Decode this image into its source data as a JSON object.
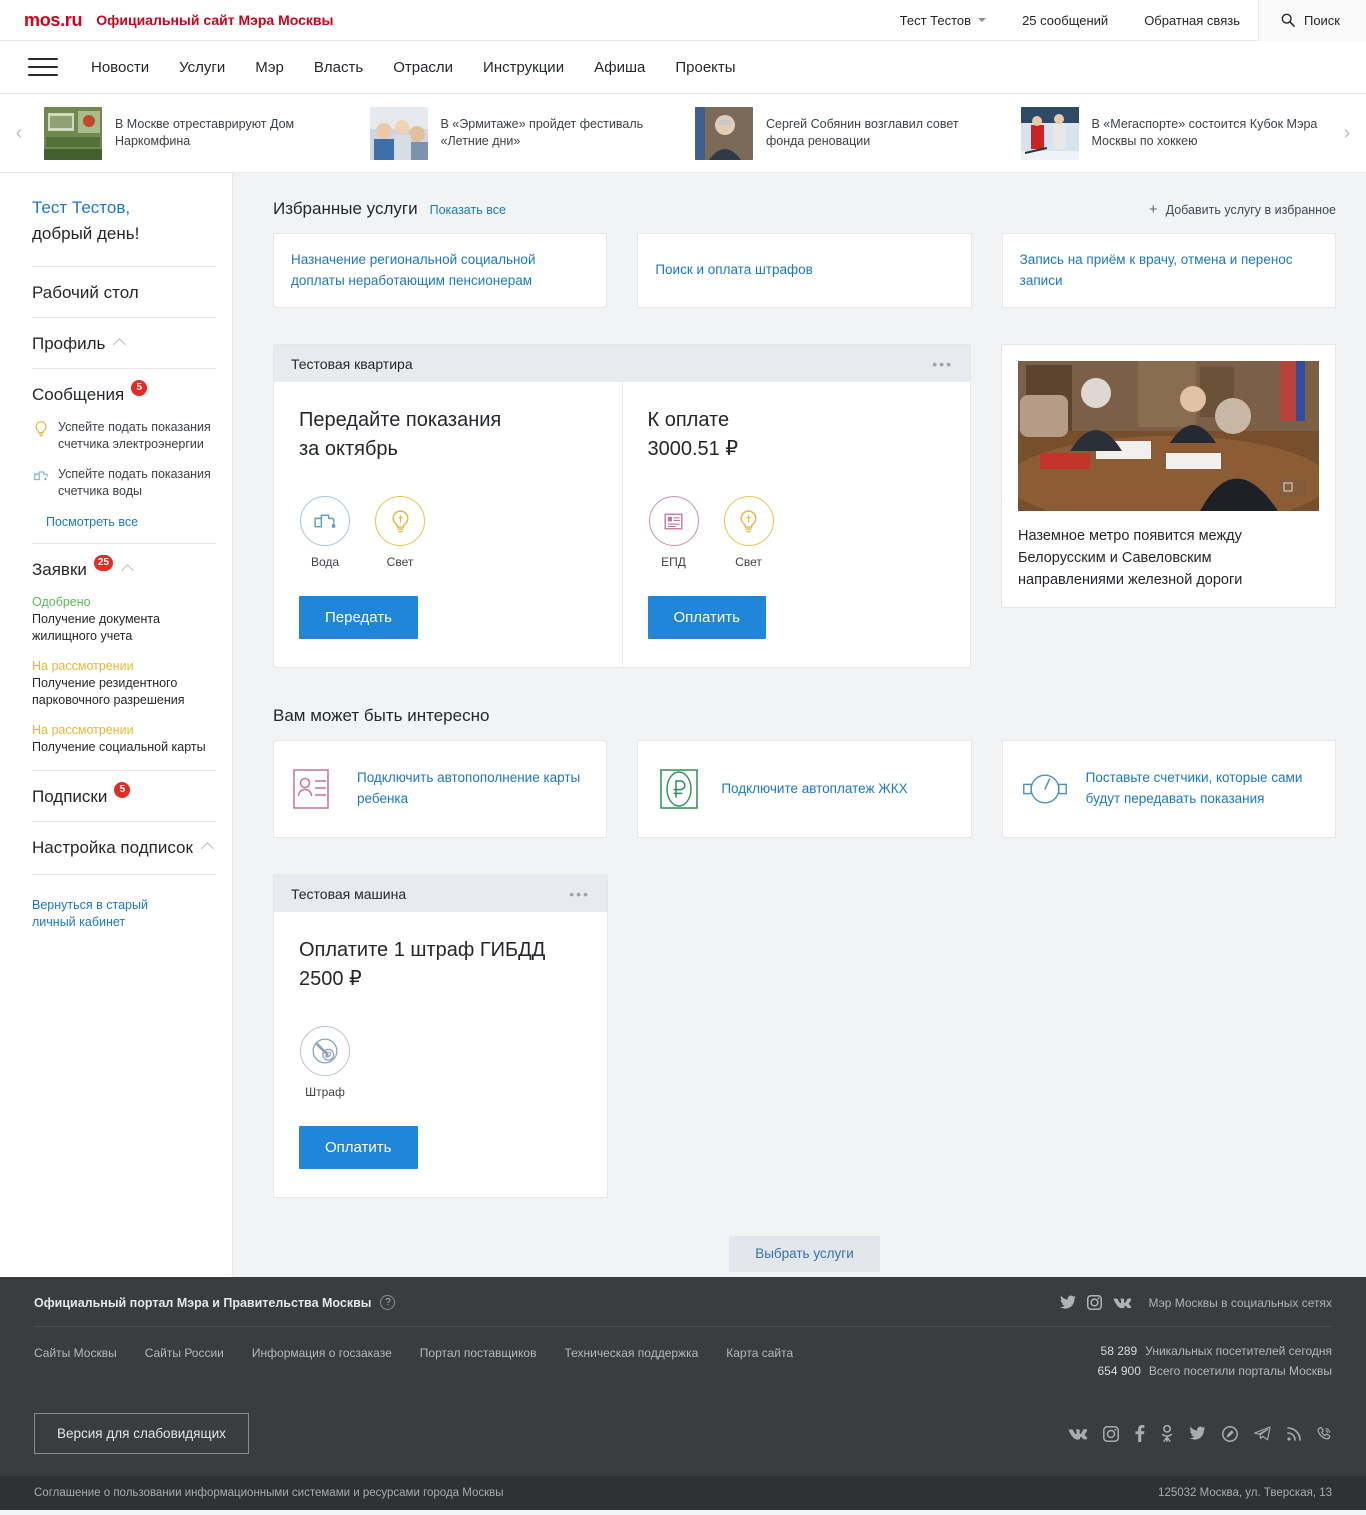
{
  "topbar": {
    "logo": "mos.ru",
    "tagline": "Официальный сайт Мэра Москвы",
    "user": "Тест Тестов",
    "messages": "25 сообщений",
    "feedback": "Обратная связь",
    "search": "Поиск"
  },
  "nav": {
    "items": [
      "Новости",
      "Услуги",
      "Мэр",
      "Власть",
      "Отрасли",
      "Инструкции",
      "Афиша",
      "Проекты"
    ]
  },
  "ticker": {
    "items": [
      {
        "title": "В Москве отреставрируют Дом Наркомфина"
      },
      {
        "title": "В «Эрмитаже» пройдет фестиваль «Летние дни»"
      },
      {
        "title": "Сергей Собянин возглавил совет фонда реновации"
      },
      {
        "title": "В «Мегаспорте» состоится Кубок Мэра Москвы по хоккею"
      }
    ]
  },
  "sidebar": {
    "greeting_name": "Тест Тестов,",
    "greeting_text": "добрый день!",
    "desktop": "Рабочий стол",
    "profile": "Профиль",
    "messages_label": "Сообщения",
    "messages_badge": "5",
    "messages": [
      {
        "icon": "lightbulb-icon",
        "text": "Успейте подать показания счетчика электроэнергии"
      },
      {
        "icon": "faucet-icon",
        "text": "Успейте подать показания счетчика воды"
      }
    ],
    "view_all": "Посмотреть все",
    "requests_label": "Заявки",
    "requests_badge": "25",
    "requests": [
      {
        "status": "Одобрено",
        "status_type": "ok",
        "title": "Получение документа жилищного учета"
      },
      {
        "status": "На рассмотрении",
        "status_type": "pending",
        "title": "Получение резидентного парковочного разрешения"
      },
      {
        "status": "На рассмотрении",
        "status_type": "pending",
        "title": "Получение социальной карты"
      }
    ],
    "subscriptions_label": "Подписки",
    "subscriptions_badge": "5",
    "subscriptions_settings": "Настройка подписок",
    "back_link_line1": "Вернуться в старый",
    "back_link_line2": "личный кабинет"
  },
  "favorites": {
    "title": "Избранные услуги",
    "show_all": "Показать все",
    "add_label": "Добавить услугу в избранное",
    "cards": [
      "Назначение региональной социальной доплаты неработающим пенсионерам",
      "Поиск и оплата штрафов",
      "Запись на приём к врачу, отмена и перенос записи"
    ]
  },
  "flat_widget": {
    "title": "Тестовая квартира",
    "left": {
      "heading_line1": "Передайте показания",
      "heading_line2": "за октябрь",
      "icons": [
        {
          "name": "faucet-icon",
          "label": "Вода"
        },
        {
          "name": "lightbulb-icon",
          "label": "Свет"
        }
      ],
      "button": "Передать"
    },
    "right": {
      "heading_line1": "К оплате",
      "heading_line2": "3000.51 ₽",
      "icons": [
        {
          "name": "bill-icon",
          "label": "ЕПД"
        },
        {
          "name": "lightbulb-icon",
          "label": "Свет"
        }
      ],
      "button": "Оплатить"
    }
  },
  "news_card": {
    "title": "Наземное метро появится между Белорусским и Савеловским направлениями железной дороги"
  },
  "interesting": {
    "title": "Вам может быть интересно",
    "cards": [
      {
        "icon": "card-person-icon",
        "text": "Подключить автопополнение карты ребенка"
      },
      {
        "icon": "ruble-icon",
        "text": "Подключите автоплатеж ЖКХ"
      },
      {
        "icon": "meter-icon",
        "text": "Поставьте счетчики, которые сами будут передавать показания"
      }
    ]
  },
  "car_widget": {
    "title": "Тестовая машина",
    "heading_line1": "Оплатите 1 штраф ГИБДД",
    "heading_line2": "2500 ₽",
    "icon_label": "Штраф",
    "button": "Оплатить"
  },
  "choose_services": "Выбрать услуги",
  "footer": {
    "portal_title": "Официальный портал Мэра и Правительства Москвы",
    "social_label": "Мэр Москвы в социальных сетях",
    "social_top": [
      "twitter-icon",
      "instagram-icon",
      "vk-icon"
    ],
    "links": [
      "Сайты Москвы",
      "Сайты России",
      "Информация о госзаказе",
      "Портал поставщиков",
      "Техническая поддержка",
      "Карта сайта"
    ],
    "stats": [
      {
        "value": "58 289",
        "label": "Уникальных посетителей сегодня"
      },
      {
        "value": "654 900",
        "label": "Всего посетили порталы Москвы"
      }
    ],
    "low_vision": "Версия для слабовидящих",
    "social_bottom": [
      "vk-icon",
      "instagram-icon",
      "facebook-icon",
      "odnoklassniki-icon",
      "twitter-icon",
      "livejournal-icon",
      "telegram-icon",
      "rss-icon",
      "viber-icon"
    ],
    "agreement": "Соглашение о пользовании информационными системами и ресурсами города Москвы",
    "address": "125032 Москва, ул. Тверская, 13"
  },
  "colors": {
    "brand_red": "#d0021b",
    "link_blue": "#1b78c9",
    "primary_button": "#1f86d9",
    "badge_red": "#e52b24",
    "status_ok": "#5eb95e",
    "status_pending": "#e8b63c",
    "footer_bg": "#3a3c3f"
  }
}
